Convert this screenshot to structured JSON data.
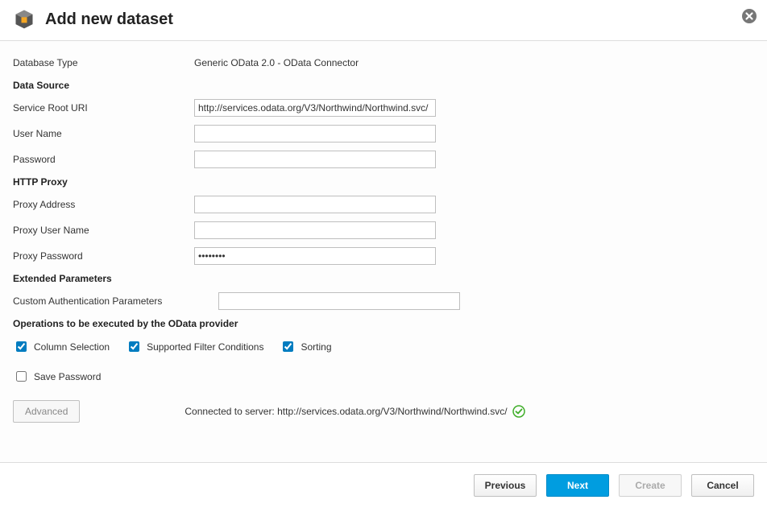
{
  "header": {
    "title": "Add new dataset"
  },
  "fields": {
    "databaseType": {
      "label": "Database Type",
      "value": "Generic OData 2.0 - OData Connector"
    },
    "dataSourceSection": "Data Source",
    "serviceRootUri": {
      "label": "Service Root URI",
      "value": "http://services.odata.org/V3/Northwind/Northwind.svc/"
    },
    "userName": {
      "label": "User Name",
      "value": ""
    },
    "password": {
      "label": "Password",
      "value": ""
    },
    "httpProxySection": "HTTP Proxy",
    "proxyAddress": {
      "label": "Proxy Address",
      "value": ""
    },
    "proxyUserName": {
      "label": "Proxy User Name",
      "value": ""
    },
    "proxyPassword": {
      "label": "Proxy Password",
      "value": "••••••••"
    },
    "extendedParamsSection": "Extended Parameters",
    "customAuthParams": {
      "label": "Custom Authentication Parameters",
      "value": ""
    },
    "operationsSection": "Operations to be executed by the OData provider",
    "columnSelection": {
      "label": "Column Selection",
      "checked": true
    },
    "supportedFilterConditions": {
      "label": "Supported Filter Conditions",
      "checked": true
    },
    "sorting": {
      "label": "Sorting",
      "checked": true
    },
    "savePassword": {
      "label": "Save Password",
      "checked": false
    },
    "advancedButton": "Advanced",
    "connectionStatus": "Connected to server: http://services.odata.org/V3/Northwind/Northwind.svc/"
  },
  "footer": {
    "previous": "Previous",
    "next": "Next",
    "create": "Create",
    "cancel": "Cancel"
  }
}
